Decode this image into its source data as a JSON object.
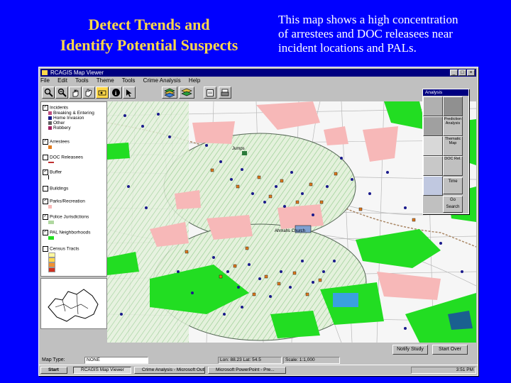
{
  "slide": {
    "title_lines": [
      "Detect Trends and",
      "Identify Potential Suspects"
    ],
    "body_lines": [
      "This map shows a high concentration",
      "of arrestees and DOC releasees near",
      "incident locations and PALs."
    ],
    "title_color": "#ffd84a",
    "background": "#0000ff"
  },
  "window": {
    "title": "RCAGIS Map Viewer",
    "menu": [
      "File",
      "Edit",
      "Tools",
      "Theme",
      "Tools",
      "Crime Analysis",
      "Help"
    ],
    "buttons": [
      "minimize",
      "maximize",
      "close"
    ]
  },
  "toolbar": {
    "tools": [
      "zoom-in-icon",
      "zoom-out-icon",
      "hand-icon",
      "bookmark-icon",
      "identify-icon",
      "pointer-icon",
      "layers-icon",
      "layers-alt-icon",
      "query-icon",
      "print-icon"
    ]
  },
  "legend": {
    "layers": [
      {
        "label": "Incidents",
        "checked": true
      },
      {
        "label": "Breaking & Entering",
        "checked": false
      },
      {
        "label": "Home Invasion",
        "checked": false
      },
      {
        "label": "Other",
        "checked": false
      },
      {
        "label": "Robbery",
        "checked": false
      },
      {
        "label": "Arrestees",
        "checked": true
      },
      {
        "label": "DOC Releasees",
        "checked": false
      },
      {
        "label": "Buffer",
        "checked": true
      },
      {
        "label": "Buildings",
        "checked": false
      },
      {
        "label": "Parks/Recreation",
        "checked": true
      },
      {
        "label": "Police Jurisdictions",
        "checked": true
      },
      {
        "label": "PAL Neighborhoods",
        "checked": true
      },
      {
        "label": "Census Tracts",
        "checked": false
      }
    ]
  },
  "analysis": {
    "title": "Analysis",
    "labels": [
      "Prediction Analysis",
      "Thematic Map",
      "DOC Rel.",
      "Time",
      "Go Search"
    ]
  },
  "map": {
    "labels": [
      "Jumps",
      "Ahmahs Church"
    ],
    "colors": {
      "park": "#22dd22",
      "zone": "#d9ecd0",
      "pink": "#f7b8b8",
      "road": "#b0b0b0",
      "incident": "#1a1a8c",
      "arrest": "#e07a20"
    }
  },
  "bottom": {
    "map_label": "Map Type:",
    "map_value": "NONE",
    "coords": "Lon: 88.23 Lat: 54.5",
    "scale": "Scale: 1:1,000",
    "btn_study": "Notify Study",
    "btn_start": "Start Over"
  },
  "taskbar": {
    "start": "Start",
    "tasks": [
      "RCAGIS Map Viewer",
      "Crime Analysis - Microsoft Outlook",
      "Microsoft PowerPoint - Pre..."
    ],
    "time": "3:51 PM"
  }
}
